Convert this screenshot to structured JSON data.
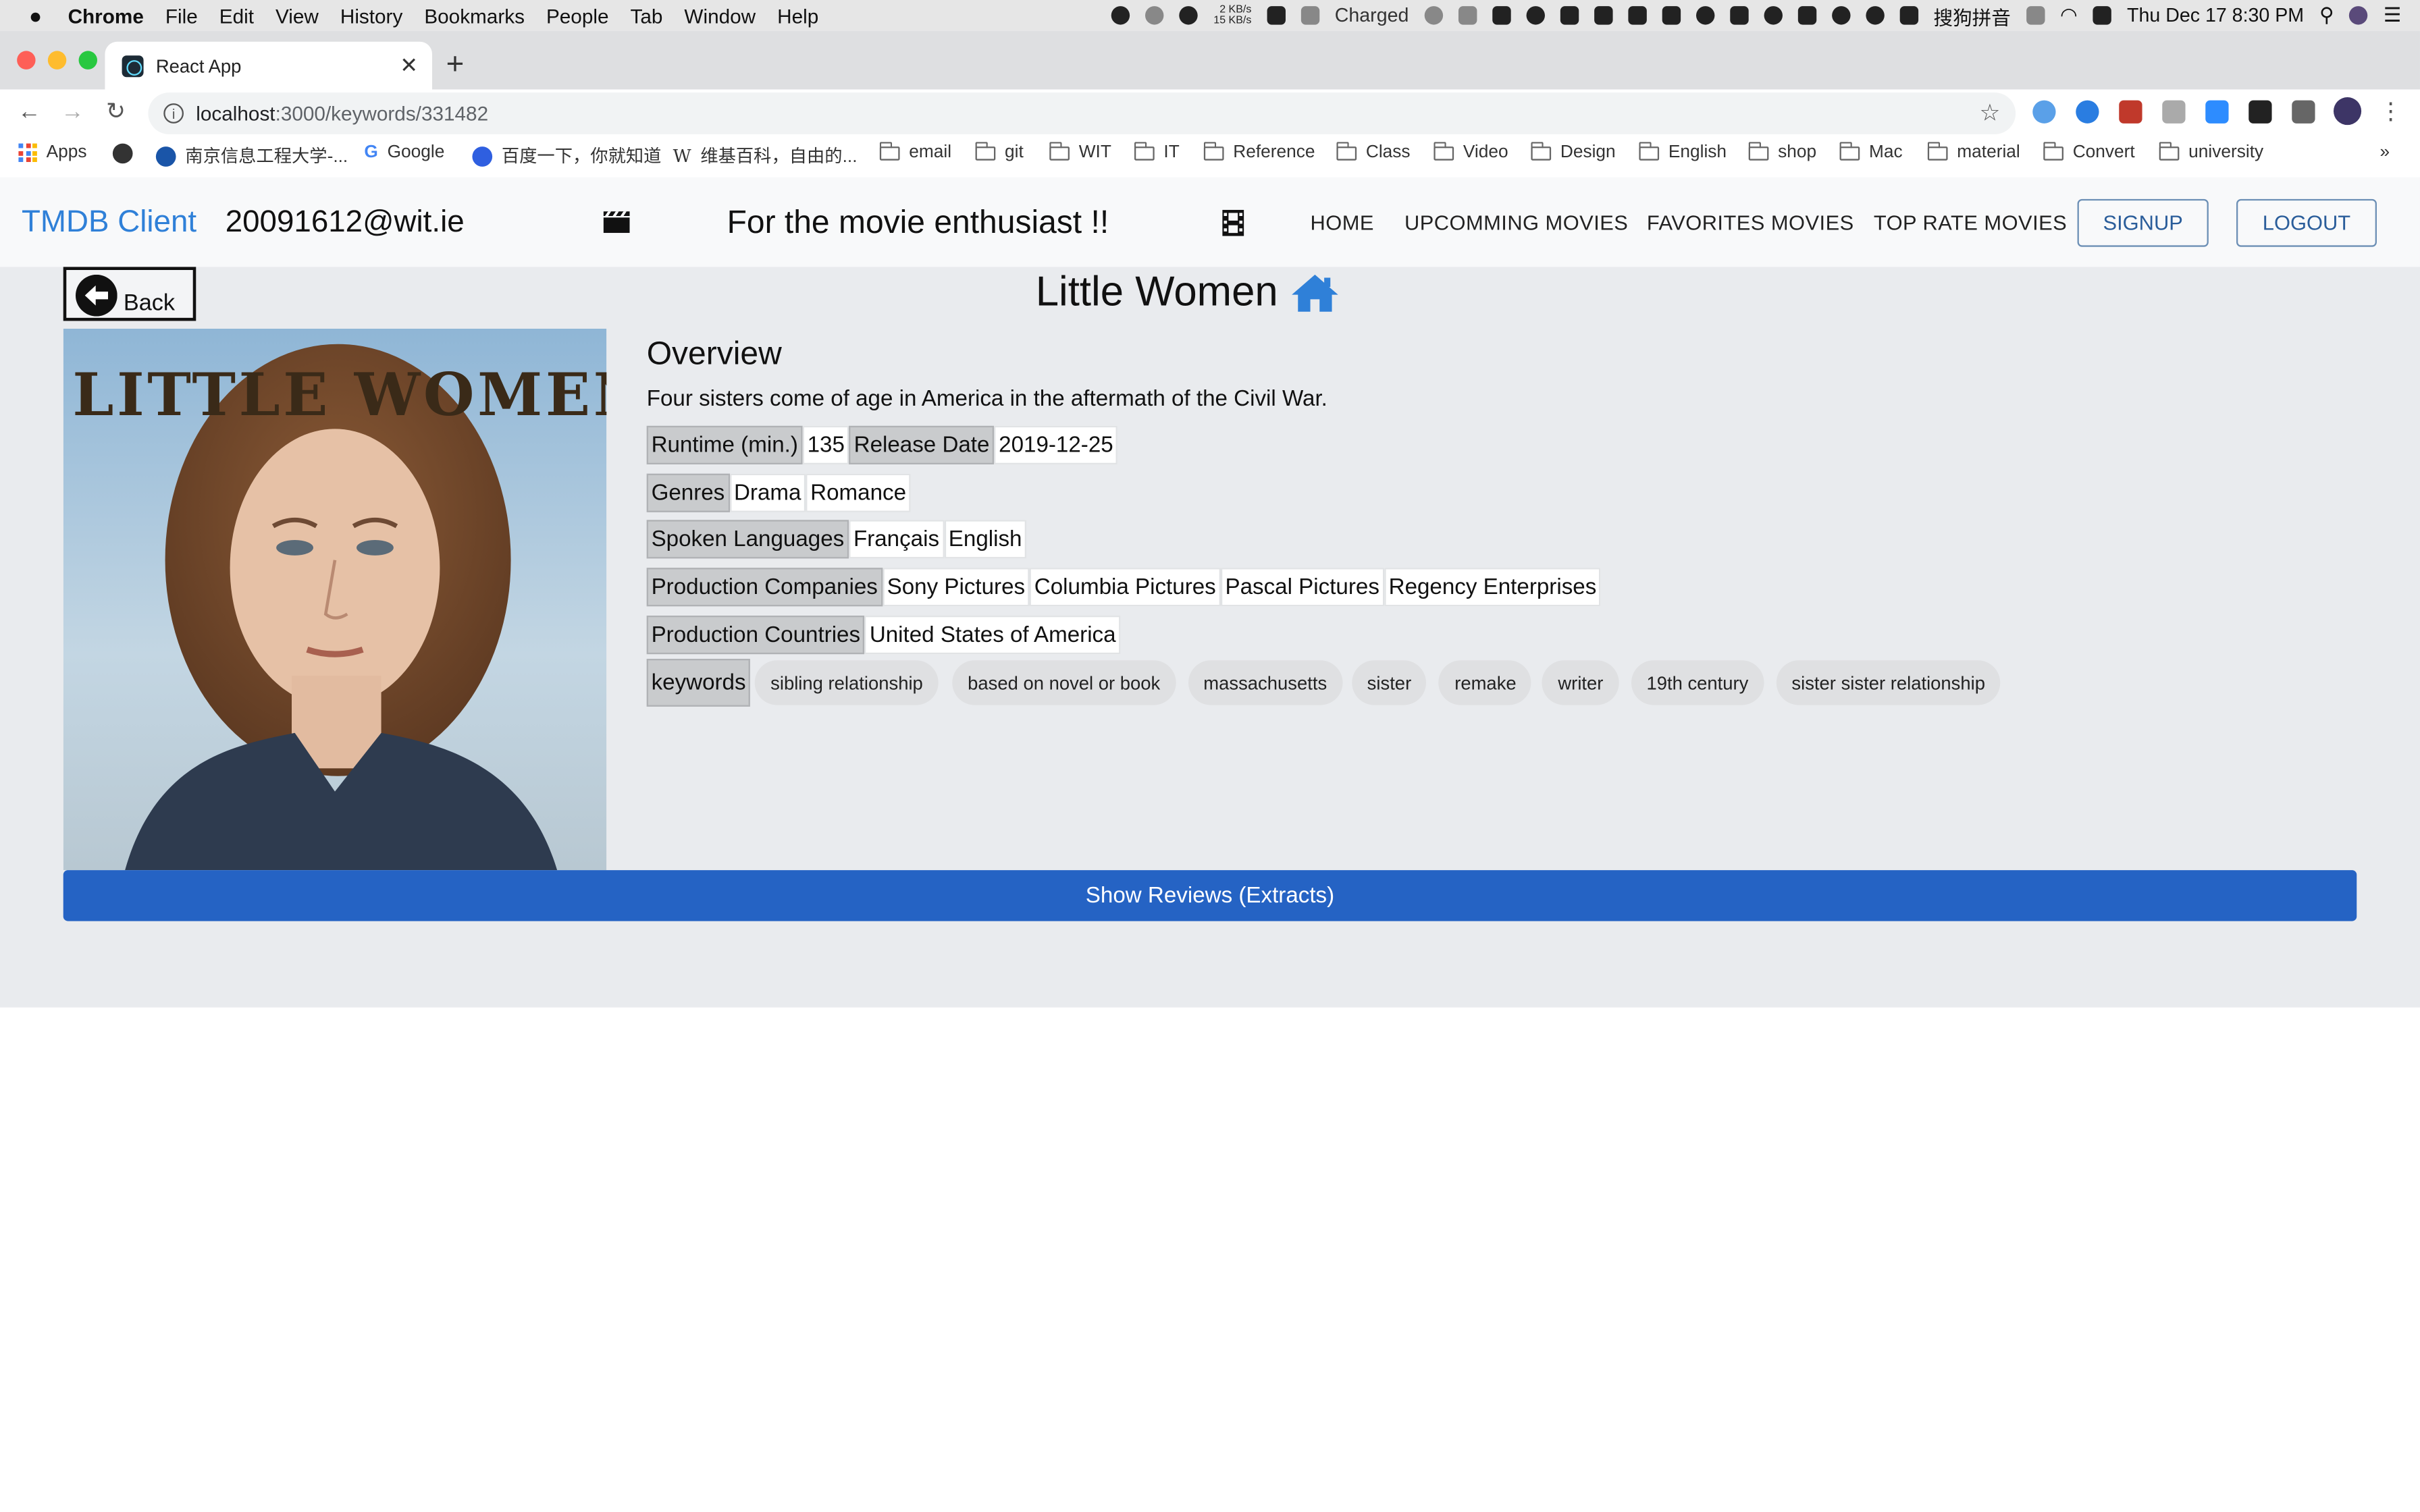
{
  "os_menubar": {
    "app_name": "Chrome",
    "menus": [
      "File",
      "Edit",
      "View",
      "History",
      "Bookmarks",
      "People",
      "Tab",
      "Window",
      "Help"
    ],
    "net_up": "2 KB/s",
    "net_down": "15 KB/s",
    "battery_status": "Charged",
    "input_method": "搜狗拼音",
    "clock": "Thu Dec 17  8:30 PM"
  },
  "browser": {
    "tab_title": "React App",
    "url_host": "localhost",
    "url_path": ":3000/keywords/331482",
    "bookmarks": [
      {
        "label": "Apps",
        "icon": "apps-grid-icon"
      },
      {
        "label": "",
        "icon": "globe-icon"
      },
      {
        "label": "南京信息工程大学-...",
        "icon": "university-logo-icon"
      },
      {
        "label": "Google",
        "icon": "google-icon"
      },
      {
        "label": "百度一下，你就知道",
        "icon": "baidu-icon"
      },
      {
        "label": "维基百科，自由的...",
        "icon": "wikipedia-icon"
      },
      {
        "label": "email",
        "icon": "folder-icon"
      },
      {
        "label": "git",
        "icon": "folder-icon"
      },
      {
        "label": "WIT",
        "icon": "folder-icon"
      },
      {
        "label": "IT",
        "icon": "folder-icon"
      },
      {
        "label": "Reference",
        "icon": "folder-icon"
      },
      {
        "label": "Class",
        "icon": "folder-icon"
      },
      {
        "label": "Video",
        "icon": "folder-icon"
      },
      {
        "label": "Design",
        "icon": "folder-icon"
      },
      {
        "label": "English",
        "icon": "folder-icon"
      },
      {
        "label": "shop",
        "icon": "folder-icon"
      },
      {
        "label": "Mac",
        "icon": "folder-icon"
      },
      {
        "label": "material",
        "icon": "folder-icon"
      },
      {
        "label": "Convert",
        "icon": "folder-icon"
      },
      {
        "label": "university",
        "icon": "folder-icon"
      }
    ],
    "overflow": "»"
  },
  "appbar": {
    "brand": "TMDB Client",
    "user_email": "20091612@wit.ie",
    "tagline": "For the movie enthusiast !!",
    "nav": [
      "HOME",
      "UPCOMMING MOVIES",
      "FAVORITES MOVIES",
      "TOP RATE MOVIES"
    ],
    "signup": "SIGNUP",
    "logout": "LOGOUT"
  },
  "movie": {
    "back_label": "Back",
    "title": "Little Women",
    "poster_title": "LITTLE WOMEN",
    "overview_heading": "Overview",
    "overview": "Four sisters come of age in America in the aftermath of the Civil War.",
    "runtime_label": "Runtime (min.)",
    "runtime": "135",
    "release_label": "Release Date",
    "release_date": "2019-12-25",
    "genres_label": "Genres",
    "genres": [
      "Drama",
      "Romance"
    ],
    "languages_label": "Spoken Languages",
    "languages": [
      "Français",
      "English"
    ],
    "companies_label": "Production Companies",
    "companies": [
      "Sony Pictures",
      "Columbia Pictures",
      "Pascal Pictures",
      "Regency Enterprises"
    ],
    "countries_label": "Production Countries",
    "countries": [
      "United States of America"
    ],
    "keywords_label": "keywords",
    "keywords": [
      "sibling relationship",
      "based on novel or book",
      "massachusetts",
      "sister",
      "remake",
      "writer",
      "19th century",
      "sister sister relationship"
    ],
    "reviews_button": "Show Reviews (Extracts)"
  },
  "colors": {
    "brand": "#2f80d8",
    "primary_button": "#2563c4",
    "page_bg": "#e9ebee",
    "home_icon": "#2f80d8"
  }
}
